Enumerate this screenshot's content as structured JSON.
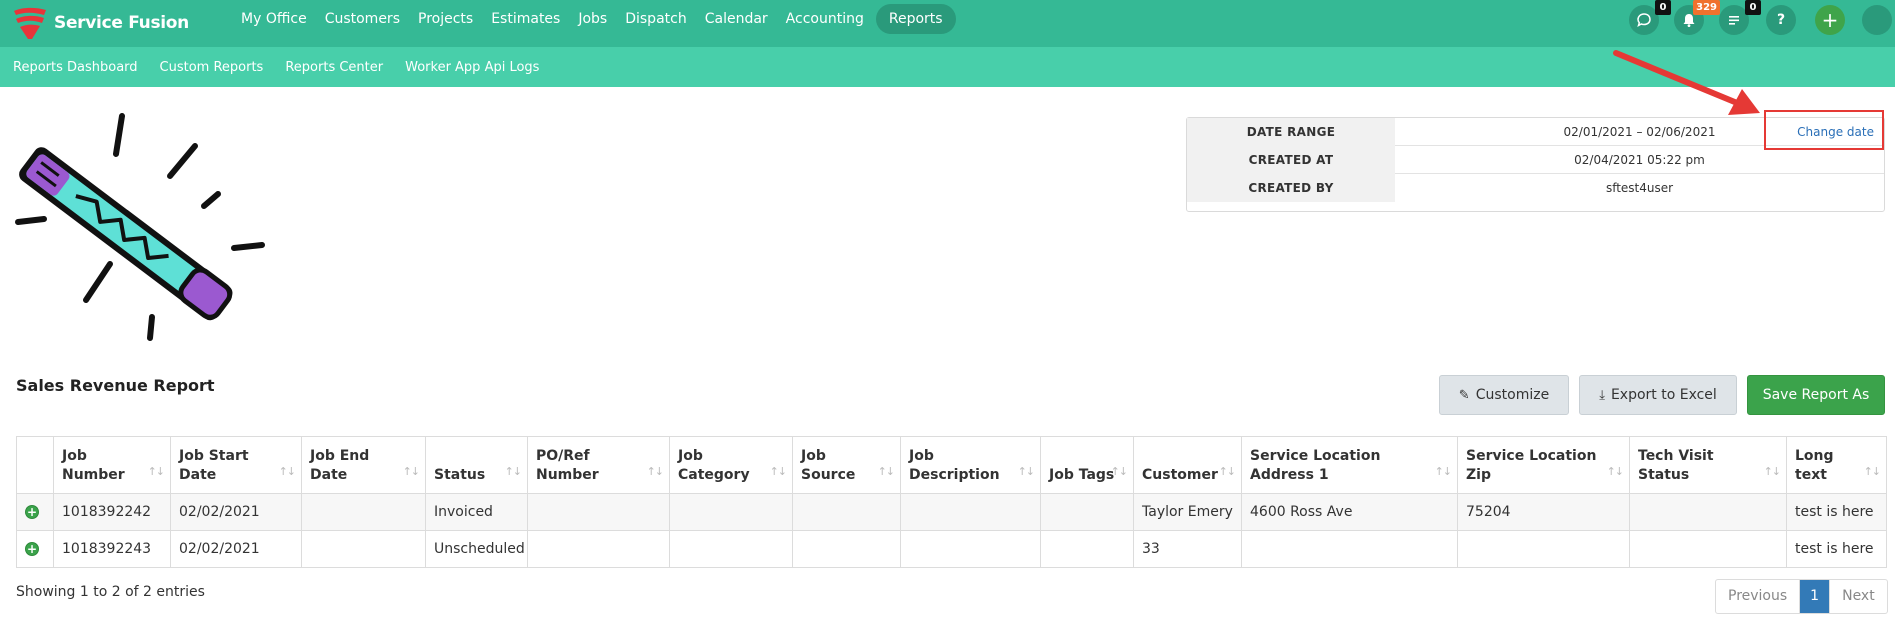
{
  "app": {
    "brand": "Service Fusion",
    "accent": "#35b995",
    "sub_accent": "#48cfaa"
  },
  "nav": {
    "items": [
      {
        "label": "My Office"
      },
      {
        "label": "Customers"
      },
      {
        "label": "Projects"
      },
      {
        "label": "Estimates"
      },
      {
        "label": "Jobs"
      },
      {
        "label": "Dispatch"
      },
      {
        "label": "Calendar"
      },
      {
        "label": "Accounting"
      },
      {
        "label": "Reports",
        "active": true
      }
    ]
  },
  "top_icons": {
    "chat_badge": "0",
    "notifications_badge": "329",
    "tasks_badge": "0",
    "help_label": "?",
    "add_label": "+"
  },
  "subnav": {
    "items": [
      {
        "label": "Reports Dashboard"
      },
      {
        "label": "Custom Reports"
      },
      {
        "label": "Reports Center"
      },
      {
        "label": "Worker App Api Logs"
      }
    ]
  },
  "info": {
    "date_range_label": "DATE RANGE",
    "date_range_value": "02/01/2021 – 02/06/2021",
    "change_date_link": "Change date",
    "created_at_label": "CREATED AT",
    "created_at_value": "02/04/2021 05:22 pm",
    "created_by_label": "CREATED BY",
    "created_by_value": "sftest4user"
  },
  "report": {
    "title": "Sales Revenue Report",
    "customize_label": "Customize",
    "export_label": "Export to Excel",
    "save_label": "Save Report As"
  },
  "table": {
    "columns": [
      "Job Number",
      "Job Start Date",
      "Job End Date",
      "Status",
      "PO/Ref Number",
      "Job Category",
      "Job Source",
      "Job Description",
      "Job Tags",
      "Customer",
      "Service Location Address 1",
      "Service Location Zip",
      "Tech Visit Status",
      "Long text"
    ],
    "rows": [
      [
        "1018392242",
        "02/02/2021",
        "",
        "Invoiced",
        "",
        "",
        "",
        "",
        "",
        "Taylor Emery",
        "4600 Ross Ave",
        "75204",
        "",
        "test is here"
      ],
      [
        "1018392243",
        "02/02/2021",
        "",
        "Unscheduled",
        "",
        "",
        "",
        "",
        "",
        "33",
        "",
        "",
        "",
        "test is here"
      ]
    ]
  },
  "footer": {
    "showing": "Showing 1 to 2 of 2 entries",
    "prev_label": "Previous",
    "current_page": "1",
    "next_label": "Next"
  }
}
